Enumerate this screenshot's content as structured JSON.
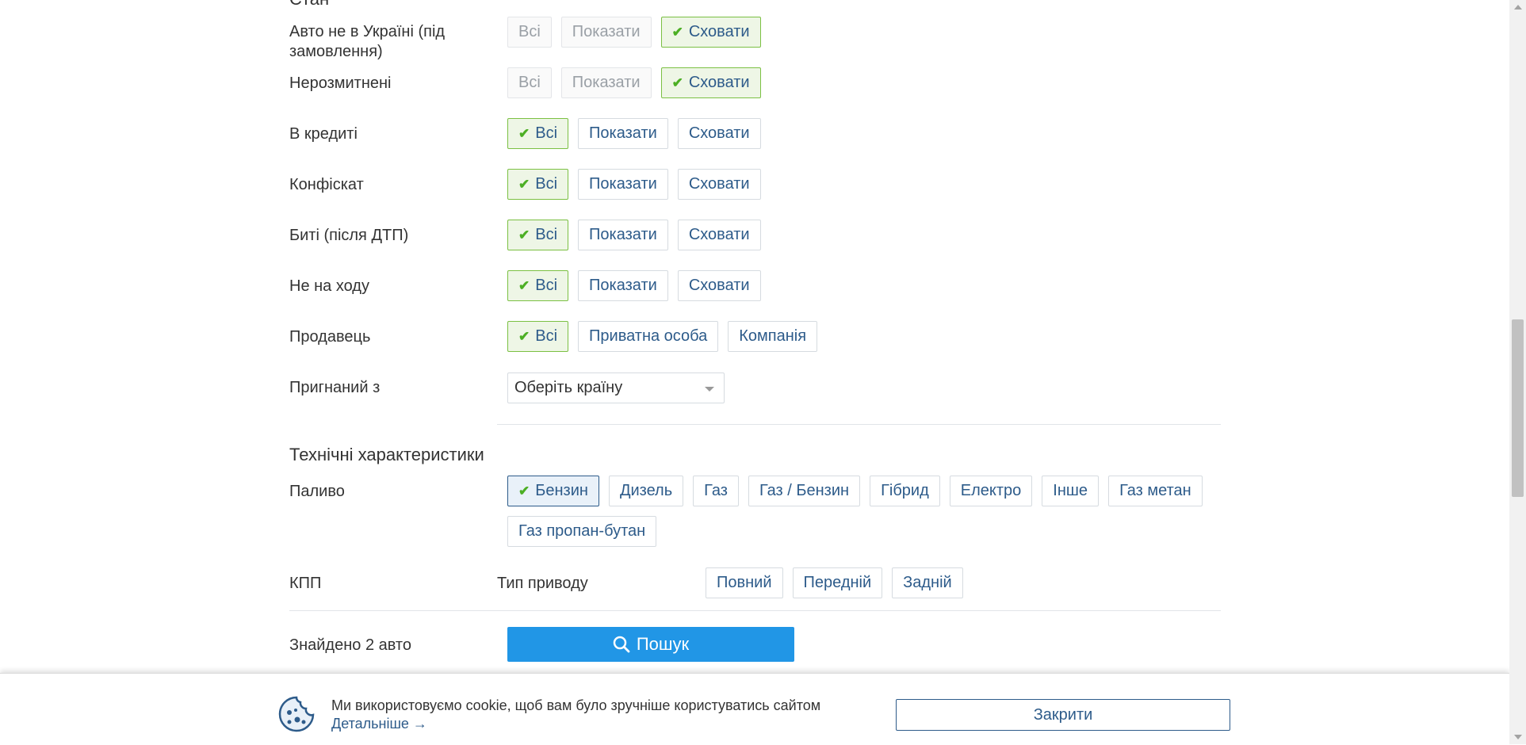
{
  "section_state": {
    "title": "Стан"
  },
  "rows": [
    {
      "label": "Авто не в Україні (під замовлення)",
      "options": [
        "Всі",
        "Показати",
        "Сховати"
      ],
      "selected": 2,
      "disabled_others": true
    },
    {
      "label": "Нерозмитнені",
      "options": [
        "Всі",
        "Показати",
        "Сховати"
      ],
      "selected": 2,
      "disabled_others": true
    },
    {
      "label": "В кредиті",
      "options": [
        "Всі",
        "Показати",
        "Сховати"
      ],
      "selected": 0
    },
    {
      "label": "Конфіскат",
      "options": [
        "Всі",
        "Показати",
        "Сховати"
      ],
      "selected": 0
    },
    {
      "label": "Биті (після ДТП)",
      "options": [
        "Всі",
        "Показати",
        "Сховати"
      ],
      "selected": 0
    },
    {
      "label": "Не на ходу",
      "options": [
        "Всі",
        "Показати",
        "Сховати"
      ],
      "selected": 0
    },
    {
      "label": "Продавець",
      "options": [
        "Всі",
        "Приватна особа",
        "Компанія"
      ],
      "selected": 0
    }
  ],
  "country": {
    "label": "Пригнаний з",
    "placeholder": "Оберіть країну"
  },
  "tech": {
    "title": "Технічні характеристики",
    "fuel_label": "Паливо",
    "fuel_options": [
      "Бензин",
      "Дизель",
      "Газ",
      "Газ / Бензин",
      "Гібрид",
      "Електро",
      "Інше",
      "Газ метан",
      "Газ пропан-бутан"
    ],
    "fuel_selected": 0,
    "gearbox_label": "КПП",
    "drive_label": "Тип приводу",
    "drive_options": [
      "Повний",
      "Передній",
      "Задній"
    ]
  },
  "results": {
    "found_text": "Знайдено 2 авто",
    "search_label": "Пошук"
  },
  "cookie": {
    "text": "Ми використовуємо cookie, щоб вам було зручніше користуватись сайтом",
    "link": "Детальніше →",
    "close_label": "Закрити"
  },
  "colors": {
    "accent": "#2196e6",
    "link": "#2d5b8a",
    "selected_border": "#7bc043",
    "check": "#4caf24"
  }
}
